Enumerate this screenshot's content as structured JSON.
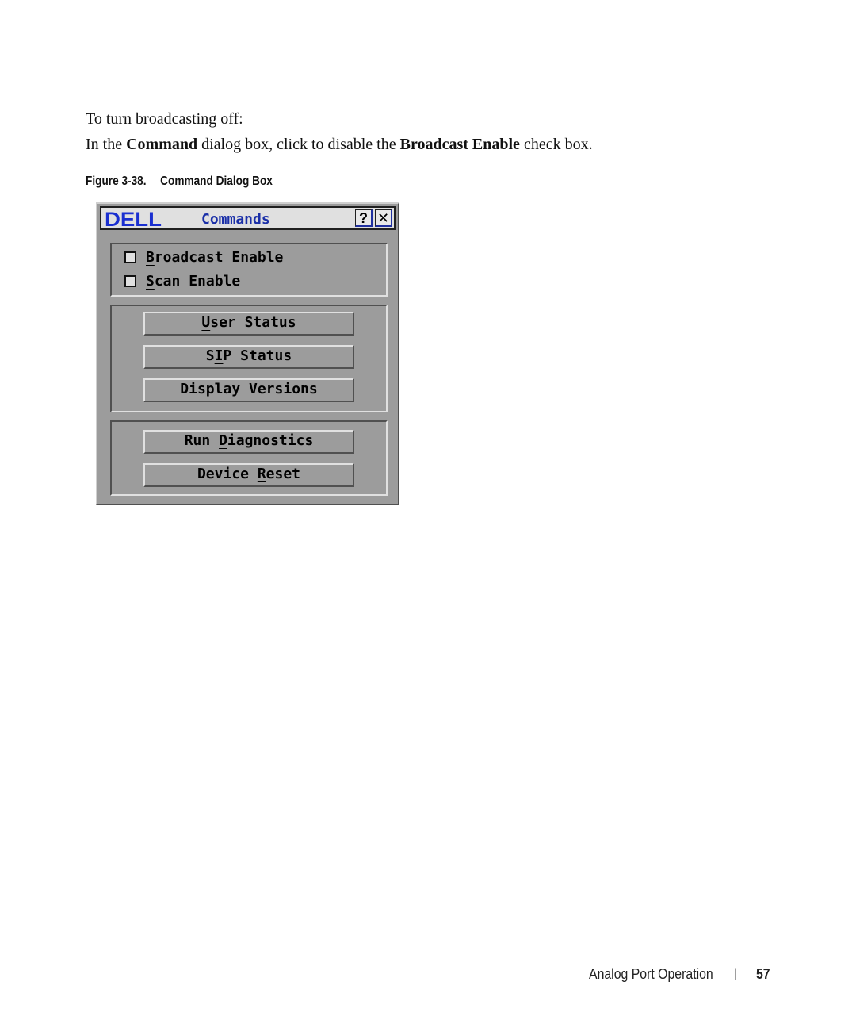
{
  "document": {
    "paragraphs": [
      {
        "segments": [
          {
            "text": "To turn broadcasting off:",
            "style": "normal"
          }
        ]
      },
      {
        "segments": [
          {
            "text": "In the ",
            "style": "normal"
          },
          {
            "text": "Command",
            "style": "emphasis"
          },
          {
            "text": " dialog box, click to disable the ",
            "style": "normal"
          },
          {
            "text": "Broadcast Enable",
            "style": "emphasis"
          },
          {
            "text": " check box.",
            "style": "normal"
          }
        ]
      }
    ],
    "figure": {
      "number": "Figure 3-38.",
      "title": "Command Dialog Box"
    }
  },
  "dialog": {
    "logo": "DELL",
    "title": "Commands",
    "help_label": "?",
    "close_label": "✕",
    "checkboxes": [
      {
        "label": "Broadcast Enable",
        "hotkey_index": 0,
        "checked": false
      },
      {
        "label": "Scan Enable",
        "hotkey_index": 0,
        "checked": false
      }
    ],
    "status_buttons": [
      {
        "label": "User Status",
        "hotkey_index": 0
      },
      {
        "label": "SIP Status",
        "hotkey_index": 1
      },
      {
        "label": "Display Versions",
        "hotkey_index": 8
      }
    ],
    "action_buttons": [
      {
        "label": "Run Diagnostics",
        "hotkey_index": 4
      },
      {
        "label": "Device Reset",
        "hotkey_index": 7
      }
    ],
    "colors": {
      "title_text": "#1a2fa8",
      "logo": "#1a2fd0",
      "window_bg": "#9c9c9c",
      "titlebar_bg": "#e0e0e0"
    }
  },
  "footer": {
    "section": "Analog Port Operation",
    "separator": "|",
    "page": "57"
  }
}
